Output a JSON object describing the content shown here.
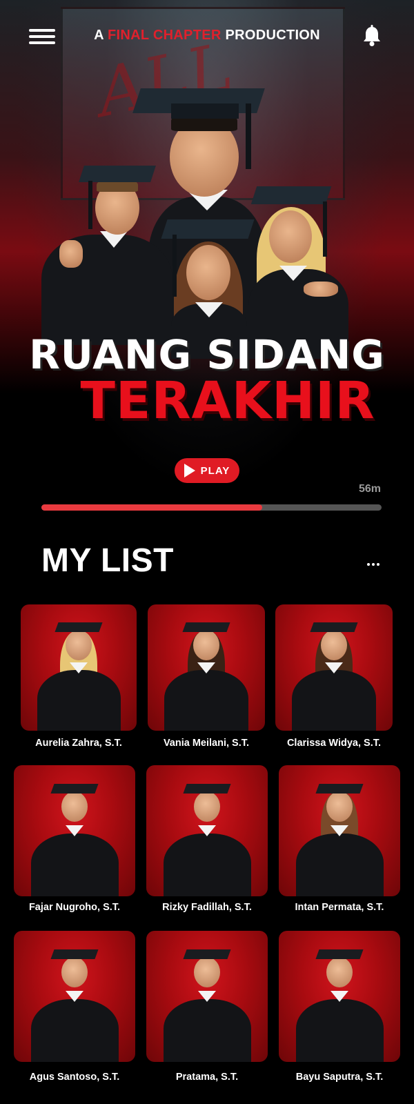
{
  "header": {
    "brand_prefix": "A",
    "brand_highlight": "FINAL CHAPTER",
    "brand_suffix": "PRODUCTION",
    "menu_icon": "hamburger-menu-icon",
    "bell_icon": "bell-icon",
    "accent_color": "#e0202c"
  },
  "hero": {
    "title_line1": "RUANG SIDANG",
    "title_line2": "TERAKHIR",
    "poster_scrawl": "ALL",
    "play_label": "PLAY",
    "play_icon": "play-icon",
    "duration": "56m",
    "progress": 0.65
  },
  "my_list": {
    "title": "MY LIST",
    "more_icon": "more-dots-icon",
    "items": [
      {
        "name": "Aurelia Zahra, S.T."
      },
      {
        "name": "Vania Meilani, S.T."
      },
      {
        "name": "Clarissa Widya, S.T."
      },
      {
        "name": "Fajar Nugroho, S.T."
      },
      {
        "name": "Rizky Fadillah, S.T."
      },
      {
        "name": "Intan Permata, S.T."
      },
      {
        "name": "Agus Santoso, S.T."
      },
      {
        "name": "Pratama, S.T."
      },
      {
        "name": "Bayu Saputra, S.T."
      }
    ]
  }
}
